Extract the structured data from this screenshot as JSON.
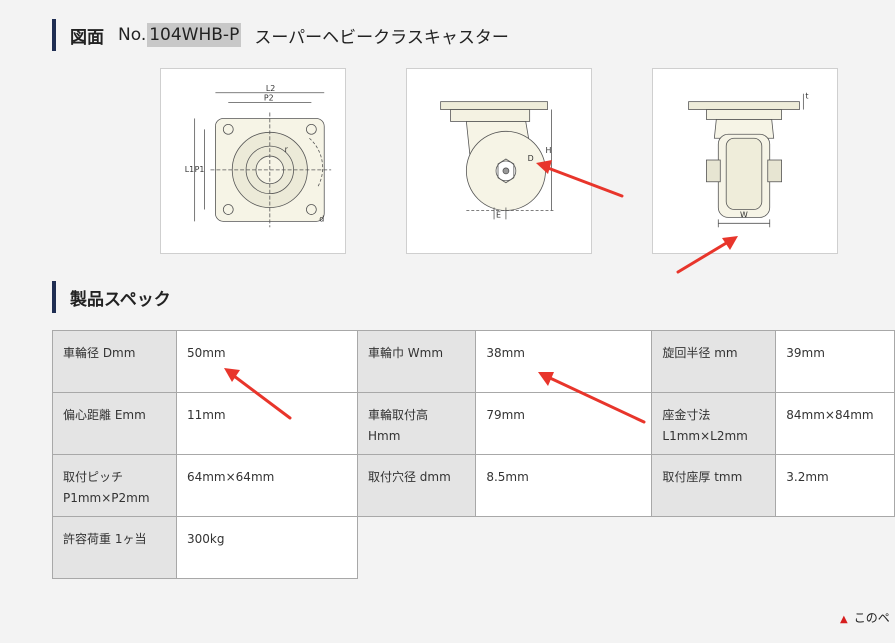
{
  "drawing_heading": {
    "label": "図面",
    "model_prefix": "No.",
    "model_code": "104WHB-P",
    "product_name": "スーパーヘビークラスキャスター"
  },
  "spec_heading": {
    "label": "製品スペック"
  },
  "figures": {
    "top_view": {
      "L2": "L2",
      "P2": "P2",
      "L1": "L1",
      "P1": "P1",
      "r": "r",
      "d": "d"
    },
    "side_view": {
      "H": "H",
      "D": "D",
      "E": "E"
    },
    "front_view": {
      "t": "t",
      "W": "W"
    }
  },
  "spec_rows": [
    [
      {
        "key": "車輪径 Dmm",
        "value": "50mm"
      },
      {
        "key": "車輪巾 Wmm",
        "value": "38mm"
      },
      {
        "key": "旋回半径 mm",
        "value": "39mm"
      }
    ],
    [
      {
        "key": "偏心距離 Emm",
        "value": "11mm"
      },
      {
        "key": "車輪取付高\nHmm",
        "value": "79mm"
      },
      {
        "key": "座金寸法\nL1mm×L2mm",
        "value": "84mm×84mm"
      }
    ],
    [
      {
        "key": "取付ピッチ\nP1mm×P2mm",
        "value": "64mm×64mm"
      },
      {
        "key": "取付穴径 dmm",
        "value": "8.5mm"
      },
      {
        "key": "取付座厚 tmm",
        "value": "3.2mm"
      }
    ],
    [
      {
        "key": "許容荷重 1ヶ当",
        "value": "300kg"
      }
    ]
  ],
  "footer": {
    "link_text": "このペ"
  },
  "colors": {
    "accent_bar": "#1f2d52",
    "arrow": "#e8352b",
    "key_cell_bg": "#e4e4e4"
  }
}
